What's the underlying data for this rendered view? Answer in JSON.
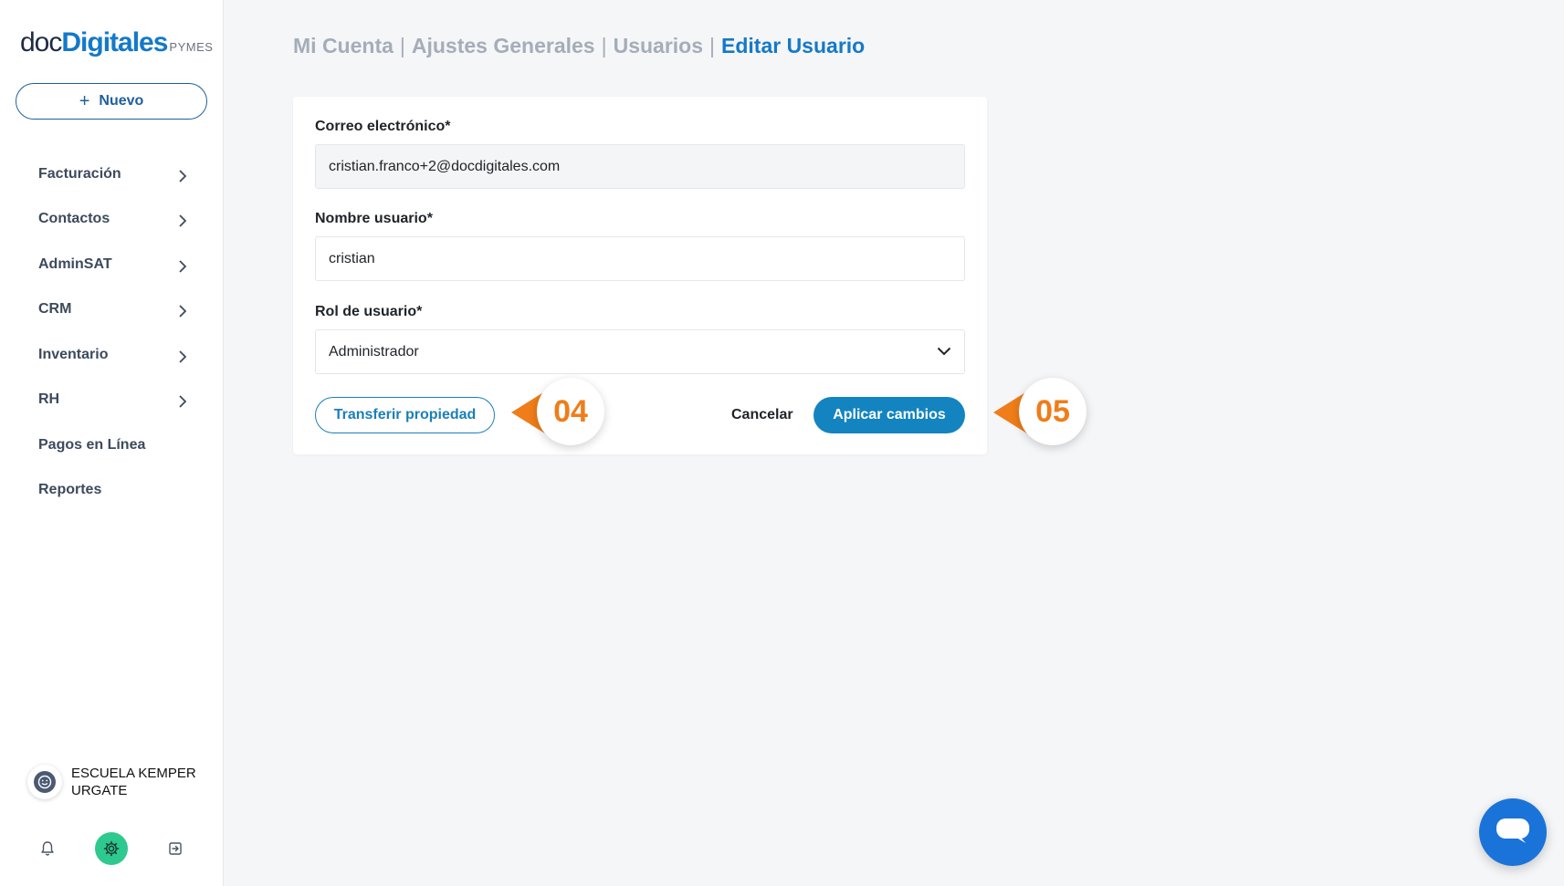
{
  "brand": {
    "prefix": "doc",
    "name": "Digitales",
    "suffix": "PYMES"
  },
  "sidebar": {
    "new_button_label": "Nuevo",
    "items": [
      {
        "label": "Facturación",
        "has_chevron": true
      },
      {
        "label": "Contactos",
        "has_chevron": true
      },
      {
        "label": "AdminSAT",
        "has_chevron": true
      },
      {
        "label": "CRM",
        "has_chevron": true
      },
      {
        "label": "Inventario",
        "has_chevron": true
      },
      {
        "label": "RH",
        "has_chevron": true
      },
      {
        "label": "Pagos en Línea",
        "has_chevron": false
      },
      {
        "label": "Reportes",
        "has_chevron": false
      }
    ],
    "account_name": "ESCUELA KEMPER URGATE",
    "bottom_icons": [
      "bell-icon",
      "gear-icon",
      "logout-icon"
    ]
  },
  "breadcrumb": {
    "items": [
      "Mi Cuenta",
      "Ajustes Generales",
      "Usuarios"
    ],
    "separator": "|",
    "current": "Editar Usuario"
  },
  "form": {
    "email_label": "Correo electrónico*",
    "email_value": "cristian.franco+2@docdigitales.com",
    "username_label": "Nombre usuario*",
    "username_value": "cristian",
    "role_label": "Rol de usuario*",
    "role_value": "Administrador",
    "transfer_button": "Transferir propiedad",
    "cancel_button": "Cancelar",
    "apply_button": "Aplicar cambios"
  },
  "markers": {
    "step_04": "04",
    "step_05": "05"
  },
  "colors": {
    "brand_blue": "#1479c9",
    "primary_button": "#1384bf",
    "marker_orange": "#ef7d1a",
    "gear_green": "#2ec98f",
    "chat_blue": "#1a73d9"
  }
}
